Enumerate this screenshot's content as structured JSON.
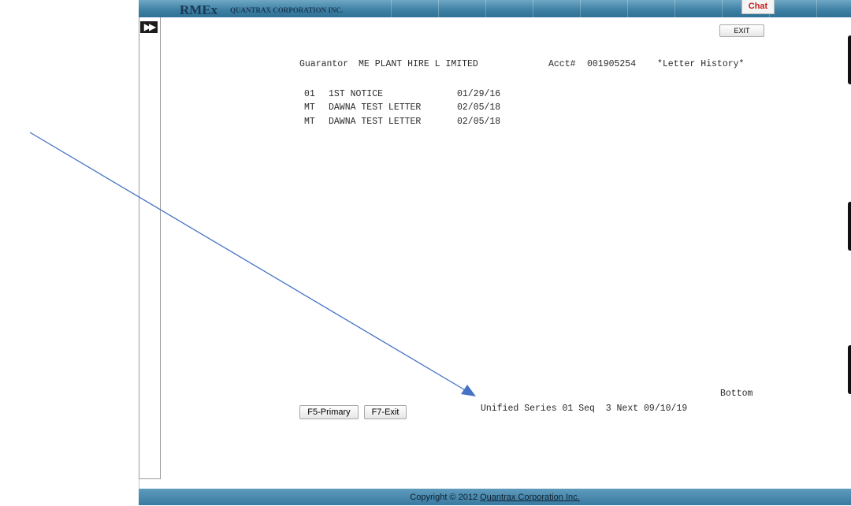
{
  "header": {
    "logo": "RMEx",
    "company": "QUANTRAX CORPORATION INC.",
    "chat_label": "Chat"
  },
  "toolbar": {
    "exit_label": "EXIT",
    "toggle_icon": "double-chevron-right-icon"
  },
  "screen": {
    "guarantor_label": "Guarantor",
    "guarantor_name": "ME PLANT HIRE L IMITED",
    "account_label": "Acct#",
    "account_number": "001905254",
    "screen_title": "*Letter History*",
    "letters": [
      {
        "code": "01",
        "name": "1ST NOTICE",
        "date": "01/29/16"
      },
      {
        "code": "MT",
        "name": "DAWNA TEST LETTER",
        "date": "02/05/18"
      },
      {
        "code": "MT",
        "name": "DAWNA TEST LETTER",
        "date": "02/05/18"
      }
    ],
    "bottom_label": "Bottom",
    "status_line": "Unified Series 01 Seq  3 Next 09/10/19"
  },
  "function_keys": {
    "f5_label": "F5-Primary",
    "f7_label": "F7-Exit"
  },
  "footer": {
    "copyright_prefix": "Copyright © 2012",
    "copyright_link": "Quantrax Corporation Inc."
  },
  "colors": {
    "header_band": "#3d7fa3",
    "chat_text": "#c81e1e",
    "annotation_arrow": "#4472c4"
  }
}
